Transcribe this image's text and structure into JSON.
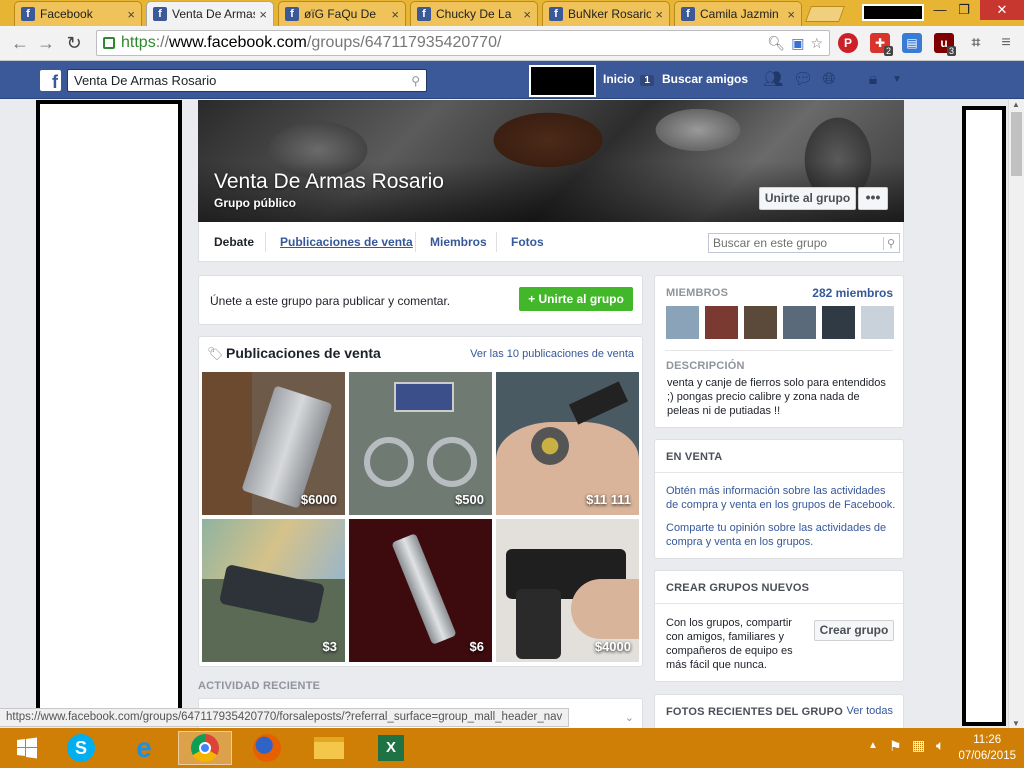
{
  "browser": {
    "tabs": [
      {
        "title": "Facebook",
        "favicon": "facebook-icon",
        "active": false
      },
      {
        "title": "Venta De Armas Rosario",
        "favicon": "facebook-icon",
        "active": true
      },
      {
        "title": "øïG FaQu De",
        "favicon": "facebook-icon",
        "active": false
      },
      {
        "title": "Chucky De La",
        "favicon": "facebook-icon",
        "active": false
      },
      {
        "title": "BuNker Rosario",
        "favicon": "facebook-icon",
        "active": false
      },
      {
        "title": "Camila Jazmin",
        "favicon": "facebook-icon",
        "active": false
      }
    ],
    "url": {
      "scheme": "https",
      "sep": "://",
      "host": "www.facebook.com",
      "path": "/groups/647117935420770/"
    },
    "status_url": "https://www.facebook.com/groups/647117935420770/forsaleposts/?referral_surface=group_mall_header_nav",
    "extension_badges": {
      "ext2": "2",
      "ublock": "3"
    }
  },
  "fb": {
    "search_value": "Venta De Armas Rosario",
    "nav": {
      "home": "Inicio",
      "home_count": "1",
      "find_friends": "Buscar amigos"
    }
  },
  "group": {
    "name": "Venta De Armas Rosario",
    "privacy": "Grupo público",
    "join_button": "Unirte al grupo",
    "more_button": "•••",
    "tabs": {
      "debate": "Debate",
      "forsale": "Publicaciones de venta",
      "members": "Miembros",
      "photos": "Fotos"
    },
    "search_placeholder": "Buscar en este grupo",
    "join_prompt": {
      "text": "Únete a este grupo para publicar y comentar.",
      "button": "Unirte al grupo"
    },
    "forsale": {
      "title": "Publicaciones de venta",
      "see_all": "Ver las 10 publicaciones de venta",
      "items": [
        {
          "price": "$6000",
          "bg": "#6e5a48"
        },
        {
          "price": "$500",
          "bg": "#6f7a73"
        },
        {
          "price": "$11 111",
          "bg": "#4a5a63"
        },
        {
          "price": "$3",
          "bg": "#5b6a55"
        },
        {
          "price": "$6",
          "bg": "#3d0b0d"
        },
        {
          "price": "$4000",
          "bg": "#e3e0dc"
        }
      ]
    },
    "recent_activity": "ACTIVIDAD RECIENTE"
  },
  "sidebar": {
    "members": {
      "heading": "MIEMBROS",
      "count": "282 miembros",
      "avatar_colors": [
        "#8aa3b8",
        "#7a3a32",
        "#5b4a3a",
        "#5a6a7a",
        "#2f3a44",
        "#c9d2da"
      ]
    },
    "description": {
      "heading": "DESCRIPCIÓN",
      "text": "venta y canje de fierros solo para entendidos ;) pongas precio calibre y zona nada de peleas ni de putiadas !!"
    },
    "for_sale": {
      "heading": "EN VENTA",
      "link1": "Obtén más información sobre las actividades de compra y venta en los grupos de Facebook.",
      "link2": "Comparte tu opinión sobre las actividades de compra y venta en los grupos."
    },
    "create_group": {
      "heading": "CREAR GRUPOS NUEVOS",
      "text": "Con los grupos, compartir con amigos, familiares y compañeros de equipo es más fácil que nunca.",
      "button": "Crear grupo"
    },
    "recent_photos": {
      "heading": "FOTOS RECIENTES DEL GRUPO",
      "link": "Ver todas"
    }
  },
  "taskbar": {
    "apps": [
      "start-icon",
      "skype-icon",
      "internet-explorer-icon",
      "chrome-icon",
      "firefox-icon",
      "file-explorer-icon",
      "excel-icon"
    ],
    "time": "11:26",
    "date": "07/06/2015"
  },
  "colors": {
    "fb_blue": "#3b5998",
    "link": "#365899",
    "green": "#42b72a",
    "taskbar": "#cf7f06"
  }
}
